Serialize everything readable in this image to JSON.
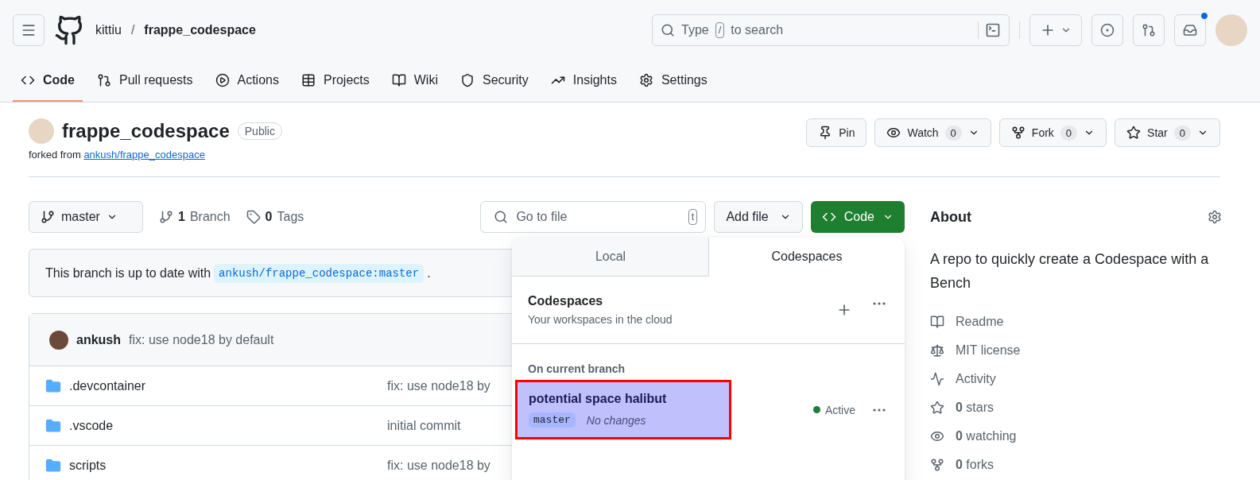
{
  "header": {
    "owner": "kittiu",
    "separator": "/",
    "repo": "frappe_codespace",
    "search": {
      "before": "Type",
      "key": "/",
      "after": "to search"
    },
    "inbox_unread": true
  },
  "nav_tabs": [
    {
      "label": "Code",
      "selected": true
    },
    {
      "label": "Pull requests",
      "selected": false
    },
    {
      "label": "Actions",
      "selected": false
    },
    {
      "label": "Projects",
      "selected": false
    },
    {
      "label": "Wiki",
      "selected": false
    },
    {
      "label": "Security",
      "selected": false
    },
    {
      "label": "Insights",
      "selected": false
    },
    {
      "label": "Settings",
      "selected": false
    }
  ],
  "repo": {
    "name": "frappe_codespace",
    "visibility": "Public",
    "forked_prefix": "forked from",
    "forked_from": "ankush/frappe_codespace"
  },
  "repo_actions": [
    {
      "label": "Pin"
    },
    {
      "label": "Watch",
      "count": "0"
    },
    {
      "label": "Fork",
      "count": "0"
    },
    {
      "label": "Star",
      "count": "0"
    }
  ],
  "toolbar": {
    "branch": "master",
    "branch_count": "1",
    "branch_label": "Branch",
    "tag_count": "0",
    "tag_label": "Tags",
    "goto_placeholder": "Go to file",
    "goto_key": "t",
    "add_file": "Add file",
    "code_button": "Code"
  },
  "sync_notice": {
    "text": "This branch is up to date with",
    "ref": "ankush/frappe_codespace:master",
    "suffix": "."
  },
  "latest_commit": {
    "author": "ankush",
    "message": "fix: use node18 by default"
  },
  "files": [
    {
      "name": ".devcontainer",
      "message": "fix: use node18 by"
    },
    {
      "name": ".vscode",
      "message": "initial commit"
    },
    {
      "name": "scripts",
      "message": "fix: use node18 by"
    }
  ],
  "code_menu": {
    "tabs": [
      {
        "label": "Local",
        "selected": false
      },
      {
        "label": "Codespaces",
        "selected": true
      }
    ],
    "title": "Codespaces",
    "subtitle": "Your workspaces in the cloud",
    "section": "On current branch",
    "codespaces": [
      {
        "name": "potential space halibut",
        "branch": "master",
        "changes": "No changes",
        "status": "Active",
        "selected": true
      }
    ]
  },
  "about": {
    "title": "About",
    "description": "A repo to quickly create a Codespace with a Bench",
    "links": [
      {
        "label": "Readme"
      },
      {
        "label": "MIT license"
      },
      {
        "label": "Activity"
      },
      {
        "count": "0",
        "label": "stars"
      },
      {
        "count": "0",
        "label": "watching"
      },
      {
        "count": "0",
        "label": "forks"
      }
    ]
  }
}
